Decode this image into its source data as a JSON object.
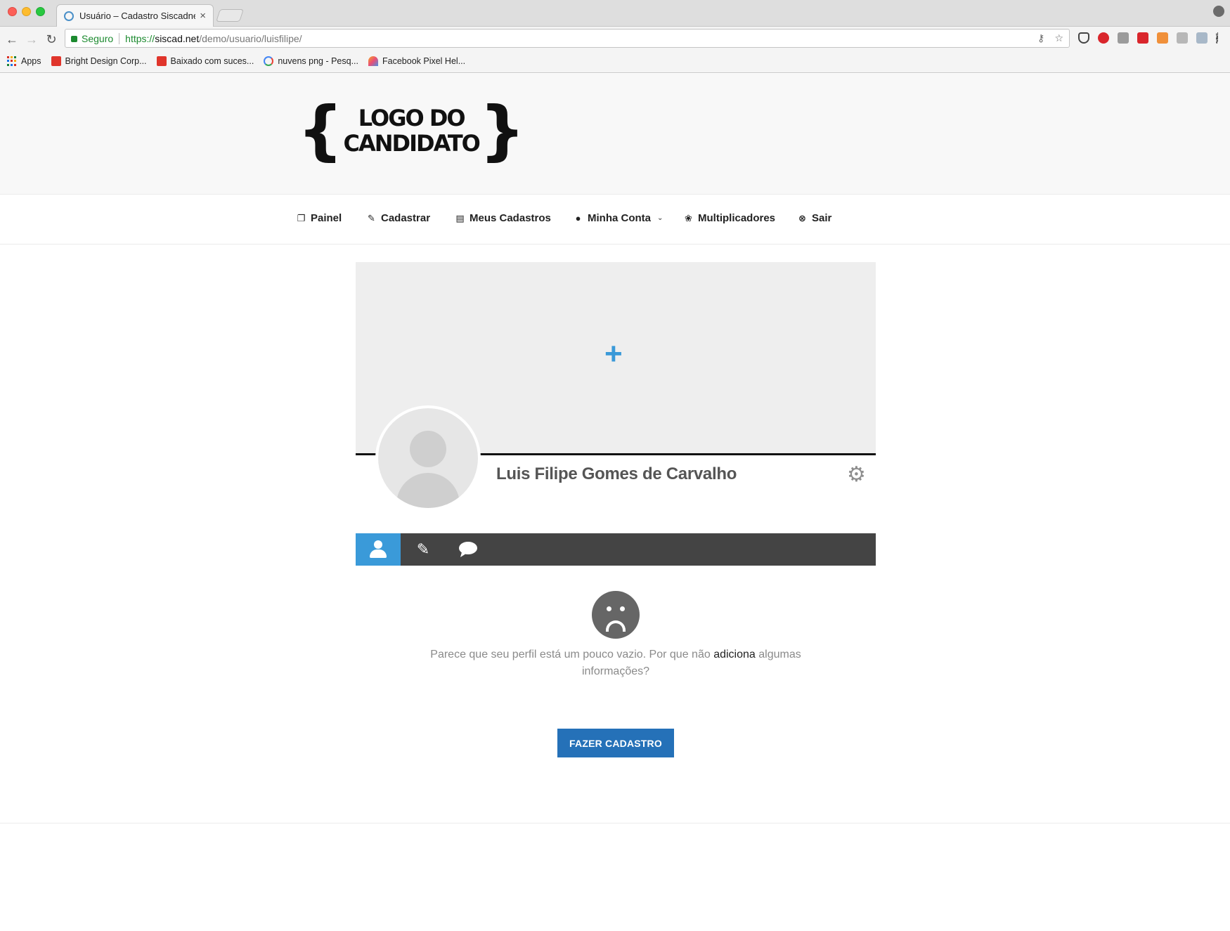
{
  "browser": {
    "tab_title": "Usuário – Cadastro Siscadnet",
    "tab_close": "×",
    "secure_label": "Seguro",
    "url_scheme": "https://",
    "url_host": "siscad.net",
    "url_path": "/demo/usuario/luisfilipe/",
    "bookmarks": [
      {
        "label": "Apps"
      },
      {
        "label": "Bright Design Corp..."
      },
      {
        "label": "Baixado com suces..."
      },
      {
        "label": "nuvens png - Pesq..."
      },
      {
        "label": "Facebook Pixel Hel..."
      }
    ]
  },
  "header": {
    "logo_line1": "LOGO DO",
    "logo_line2": "CANDIDATO",
    "logo_open_brace": "{",
    "logo_close_brace": "}"
  },
  "nav": {
    "items": [
      {
        "label": "Painel",
        "icon": "copy-icon"
      },
      {
        "label": "Cadastrar",
        "icon": "edit-icon"
      },
      {
        "label": "Meus Cadastros",
        "icon": "document-icon"
      },
      {
        "label": "Minha Conta",
        "icon": "user-icon"
      },
      {
        "label": "Multiplicadores",
        "icon": "group-icon"
      },
      {
        "label": "Sair",
        "icon": "close-circle-icon"
      }
    ]
  },
  "profile": {
    "cover_add": "+",
    "name": "Luis Filipe Gomes de Carvalho",
    "settings_glyph": "⚙",
    "tabs": [
      {
        "name": "about",
        "icon": "user-icon"
      },
      {
        "name": "edit",
        "icon": "pencil-icon"
      },
      {
        "name": "comments",
        "icon": "comment-icon"
      }
    ]
  },
  "empty_state": {
    "text_before": "Parece que seu perfil está um pouco vazio. Por que não ",
    "link_text": "adiciona",
    "text_after": " algumas informações?",
    "button_label": "FAZER CADASTRO"
  },
  "colors": {
    "accent": "#3a9ad9",
    "button": "#2571b8",
    "tab_bar": "#444444",
    "cover": "#eeeeee"
  }
}
